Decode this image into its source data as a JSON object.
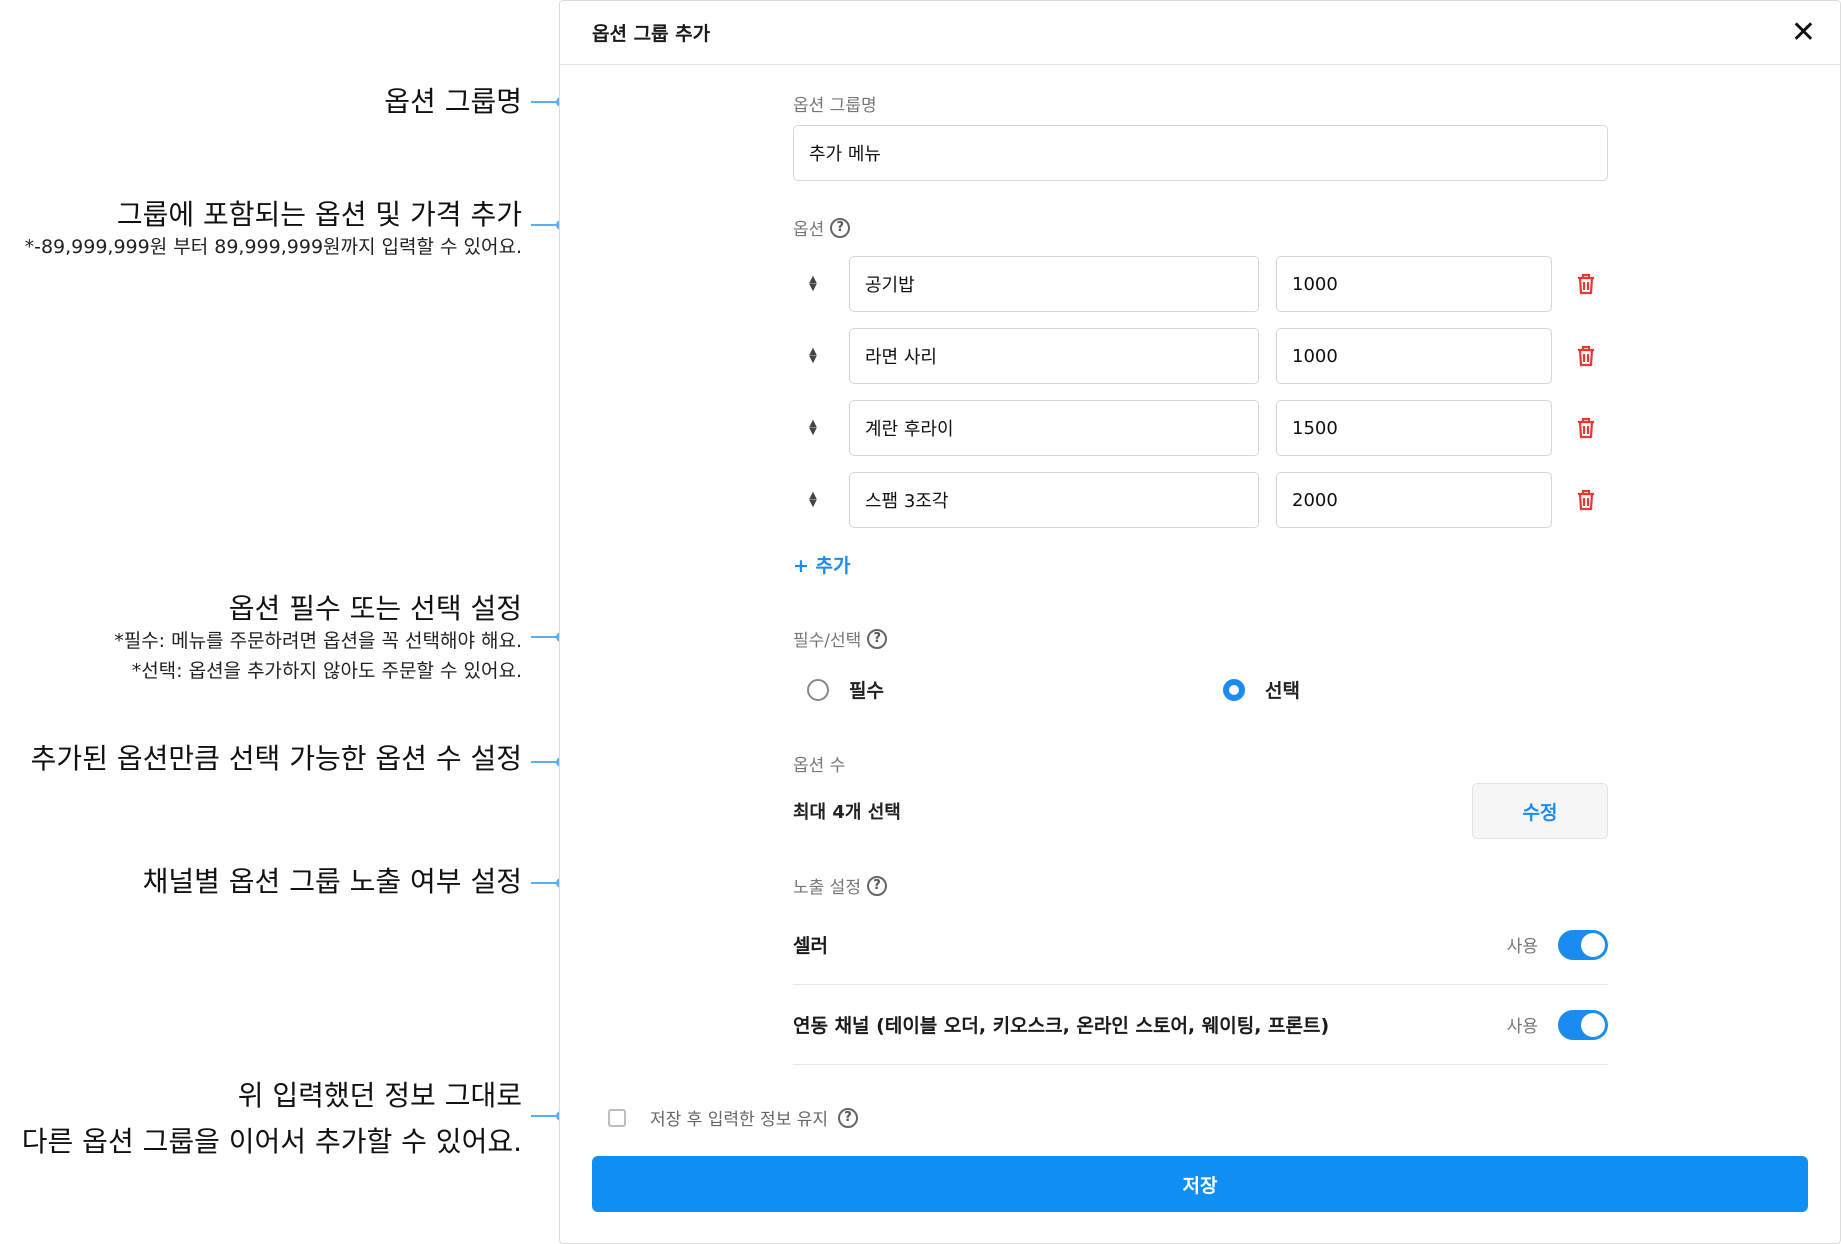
{
  "annotations": {
    "group_name": "옵션 그룹명",
    "options": "그룹에 포함되는 옵션 및 가격 추가",
    "options_note": "*-89,999,999원 부터 89,999,999원까지 입력할 수 있어요.",
    "required": "옵션 필수 또는 선택 설정",
    "required_note1": "*필수: 메뉴를 주문하려면 옵션을 꼭 선택해야 해요.",
    "required_note2": "*선택: 옵션을 추가하지 않아도 주문할 수 있어요.",
    "count": "추가된 옵션만큼 선택 가능한 옵션 수 설정",
    "visibility": "채널별 옵션 그룹 노출 여부 설정",
    "keep_line1": "위 입력했던 정보 그대로",
    "keep_line2": "다른 옵션 그룹을 이어서 추가할 수 있어요."
  },
  "modal": {
    "title": "옵션 그룹 추가",
    "close_icon": "close-icon",
    "group_name_label": "옵션 그룹명",
    "group_name_value": "추가 메뉴",
    "options_label": "옵션",
    "options": [
      {
        "name": "공기밥",
        "price": "1000"
      },
      {
        "name": "라면 사리",
        "price": "1000"
      },
      {
        "name": "계란 후라이",
        "price": "1500"
      },
      {
        "name": "스팸 3조각",
        "price": "2000"
      }
    ],
    "add_label": "+ 추가",
    "required_label": "필수/선택",
    "radio_required": "필수",
    "radio_optional": "선택",
    "selected_radio": "선택",
    "count_label": "옵션 수",
    "count_value": "최대 4개 선택",
    "edit_button": "수정",
    "visibility_label": "노출 설정",
    "channels": [
      {
        "name": "셀러",
        "status": "사용",
        "enabled": true
      },
      {
        "name": "연동 채널 (테이블 오더, 키오스크, 온라인 스토어, 웨이팅, 프론트)",
        "status": "사용",
        "enabled": true
      }
    ],
    "keep_info_label": "저장 후 입력한 정보 유지",
    "save_button": "저장"
  },
  "colors": {
    "accent": "#0f8ef4",
    "link": "#1a8cf0",
    "danger": "#e53935",
    "leader": "#5aaef2"
  }
}
